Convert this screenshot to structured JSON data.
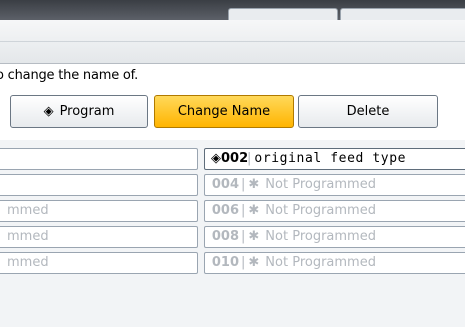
{
  "instruction": "o change the name of.",
  "buttons": {
    "program": "Program",
    "change_name": "Change Name",
    "delete": "Delete"
  },
  "left_rows": [
    {
      "text": ""
    },
    {
      "text": ""
    },
    {
      "text": "mmed"
    },
    {
      "text": "mmed"
    },
    {
      "text": "mmed"
    }
  ],
  "right_rows": [
    {
      "number": "002",
      "name": "original feed type",
      "programmed": true
    },
    {
      "number": "004",
      "name": "Not Programmed",
      "programmed": false
    },
    {
      "number": "006",
      "name": "Not Programmed",
      "programmed": false
    },
    {
      "number": "008",
      "name": "Not Programmed",
      "programmed": false
    },
    {
      "number": "010",
      "name": "Not Programmed",
      "programmed": false
    }
  ],
  "colors": {
    "accent": "#ffb400",
    "dim_text": "#b3b8be"
  }
}
